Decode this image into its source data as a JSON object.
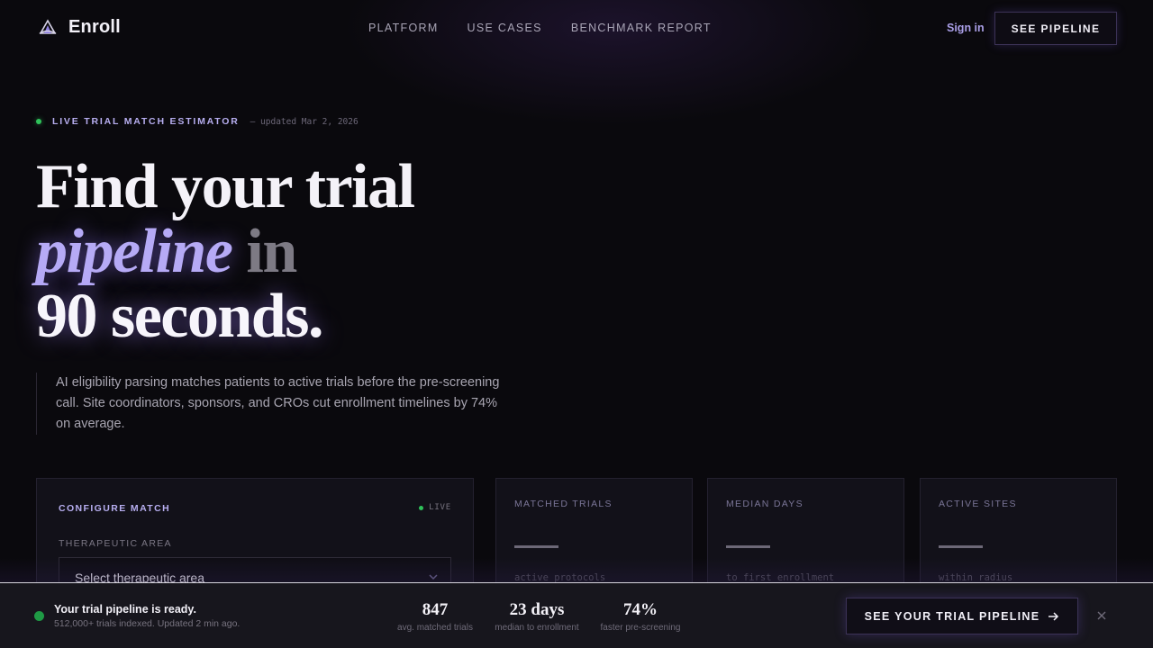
{
  "nav": {
    "brand": "Enroll",
    "links": [
      "PLATFORM",
      "USE CASES",
      "BENCHMARK REPORT"
    ],
    "sign_in": "Sign in",
    "cta": "SEE PIPELINE"
  },
  "hero": {
    "eyebrow": "LIVE TRIAL MATCH ESTIMATOR",
    "updated": "— updated Mar 2, 2026",
    "headline_line1": "Find your trial",
    "headline_em": "pipeline",
    "headline_mid": " in",
    "headline_line3": "90 seconds.",
    "subcopy": "AI eligibility parsing matches patients to active trials before the pre-screening call. Site coordinators, sponsors, and CROs cut enrollment timelines by 74% on average."
  },
  "config": {
    "title": "CONFIGURE MATCH",
    "live": "LIVE",
    "field_label": "THERAPEUTIC AREA",
    "select_value": "Select therapeutic area"
  },
  "stats": [
    {
      "label": "MATCHED TRIALS",
      "note": "active protocols"
    },
    {
      "label": "MEDIAN DAYS",
      "note": "to first enrollment"
    },
    {
      "label": "ACTIVE SITES",
      "note": "within radius"
    }
  ],
  "bottom_bar": {
    "title": "Your trial pipeline is ready.",
    "subtitle": "512,000+ trials indexed. Updated 2 min ago.",
    "metrics": [
      {
        "value": "847",
        "label": "avg. matched trials"
      },
      {
        "value": "23 days",
        "label": "median to enrollment"
      },
      {
        "value": "74%",
        "label": "faster pre-screening"
      }
    ],
    "cta": "SEE YOUR TRIAL PIPELINE"
  },
  "colors": {
    "accent": "#b6aaf6",
    "live_green": "#2fc25a",
    "background": "#0a090d"
  },
  "icons": {
    "brand": "enroll-logo-icon",
    "select": "chevron-down-icon",
    "cta": "arrow-right-icon",
    "close": "close-icon"
  }
}
